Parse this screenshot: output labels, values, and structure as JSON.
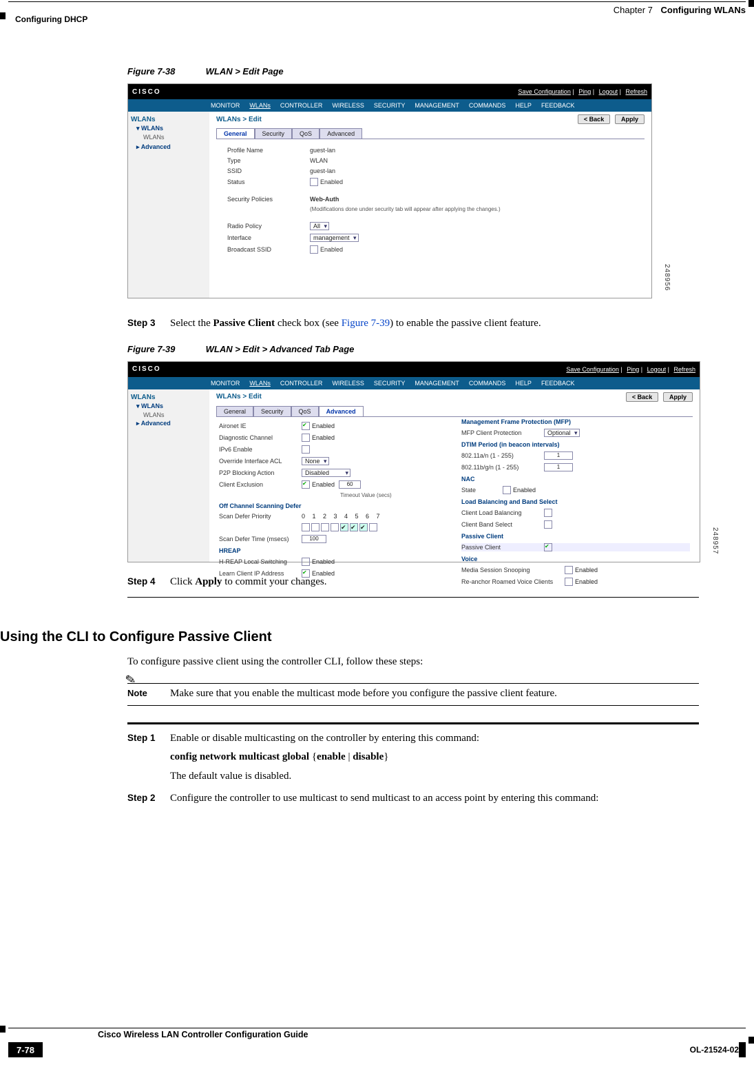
{
  "header": {
    "chapter_label": "Chapter 7",
    "chapter_title": "Configuring WLANs",
    "section_title": "Configuring DHCP"
  },
  "fig38": {
    "caption_num": "Figure 7-38",
    "caption_text": "WLAN > Edit Page",
    "side_id": "248956",
    "top": {
      "logo": "CISCO",
      "links": [
        "Save Configuration",
        "Ping",
        "Logout",
        "Refresh"
      ]
    },
    "menu": [
      "MONITOR",
      "WLANs",
      "CONTROLLER",
      "WIRELESS",
      "SECURITY",
      "MANAGEMENT",
      "COMMANDS",
      "HELP",
      "FEEDBACK"
    ],
    "side_hd": "WLANs",
    "side_items": [
      "WLANs",
      "WLANs",
      "Advanced"
    ],
    "crumb": "WLANs > Edit",
    "btn_back": "< Back",
    "btn_apply": "Apply",
    "tabs": [
      "General",
      "Security",
      "QoS",
      "Advanced"
    ],
    "rows": {
      "profile_lbl": "Profile Name",
      "profile_val": "guest-lan",
      "type_lbl": "Type",
      "type_val": "WLAN",
      "ssid_lbl": "SSID",
      "ssid_val": "guest-lan",
      "status_lbl": "Status",
      "status_val": "Enabled",
      "secpol_lbl": "Security Policies",
      "secpol_val": "Web-Auth",
      "secpol_note": "(Modifications done under security tab will appear after applying the changes.)",
      "radio_lbl": "Radio Policy",
      "radio_val": "All",
      "iface_lbl": "Interface",
      "iface_val": "management",
      "bcast_lbl": "Broadcast SSID",
      "bcast_val": "Enabled"
    }
  },
  "step3": {
    "label": "Step 3",
    "t1": "Select the ",
    "b1": "Passive Client",
    "t2": " check box (see ",
    "link": "Figure 7-39",
    "t3": ") to enable the passive client feature."
  },
  "fig39": {
    "caption_num": "Figure 7-39",
    "caption_text": "WLAN > Edit > Advanced Tab Page",
    "side_id": "248957",
    "crumb": "WLANs > Edit",
    "tabs": [
      "General",
      "Security",
      "QoS",
      "Advanced"
    ],
    "left": {
      "aironet": "Aironet IE",
      "aironet_v": "Enabled",
      "diag": "Diagnostic Channel",
      "diag_v": "Enabled",
      "ipv6": "IPv6 Enable",
      "oacl": "Override Interface ACL",
      "oacl_v": "None",
      "p2p": "P2P Blocking Action",
      "p2p_v": "Disabled",
      "cex": "Client Exclusion",
      "cex_v": "Enabled",
      "cex_to": "60",
      "cex_to_lbl": "Timeout Value (secs)",
      "ocs_hd": "Off Channel Scanning Defer",
      "sdp_lbl": "Scan Defer Priority",
      "sdp_hdr": "0  1  2  3  4  5  6  7",
      "sdt_lbl": "Scan Defer Time (msecs)",
      "sdt_val": "100",
      "hreap_hd": "HREAP",
      "hls": "H-REAP Local Switching",
      "hls_v": "Enabled",
      "lcip": "Learn Client IP Address",
      "lcip_v": "Enabled"
    },
    "right": {
      "mfp_hd": "Management Frame Protection (MFP)",
      "mfp_c": "MFP Client Protection",
      "mfp_v": "Optional",
      "dtim_hd": "DTIM Period (in beacon intervals)",
      "d11a": "802.11a/n (1 - 255)",
      "d11a_v": "1",
      "d11b": "802.11b/g/n (1 - 255)",
      "d11b_v": "1",
      "nac_hd": "NAC",
      "nac_s": "State",
      "nac_v": "Enabled",
      "lb_hd": "Load Balancing and Band Select",
      "clb": "Client Load Balancing",
      "cbs": "Client Band Select",
      "pc_hd": "Passive Client",
      "pc": "Passive Client",
      "vo_hd": "Voice",
      "mss": "Media Session Snooping",
      "mss_v": "Enabled",
      "rar": "Re-anchor Roamed Voice Clients",
      "rar_v": "Enabled"
    }
  },
  "step4": {
    "label": "Step 4",
    "t1": "Click ",
    "b1": "Apply",
    "t2": " to commit your changes."
  },
  "h2": "Using the CLI to Configure Passive Client",
  "cli_intro": "To configure passive client using the controller CLI, follow these steps:",
  "note": {
    "label": "Note",
    "text": "Make sure that you enable the multicast mode before you configure the passive client feature."
  },
  "step1": {
    "label": "Step 1",
    "t1": "Enable or disable multicasting on the controller by entering this command:",
    "cmd_a": "config network multicast global",
    "cmd_b": "{",
    "cmd_c": "enable",
    "cmd_d": " | ",
    "cmd_e": "disable",
    "cmd_f": "}",
    "t2": "The default value is disabled."
  },
  "step2": {
    "label": "Step 2",
    "t1": "Configure the controller to use multicast to send multicast to an access point by entering this command:"
  },
  "footer": {
    "guide": "Cisco Wireless LAN Controller Configuration Guide",
    "page": "7-78",
    "docid": "OL-21524-02"
  }
}
